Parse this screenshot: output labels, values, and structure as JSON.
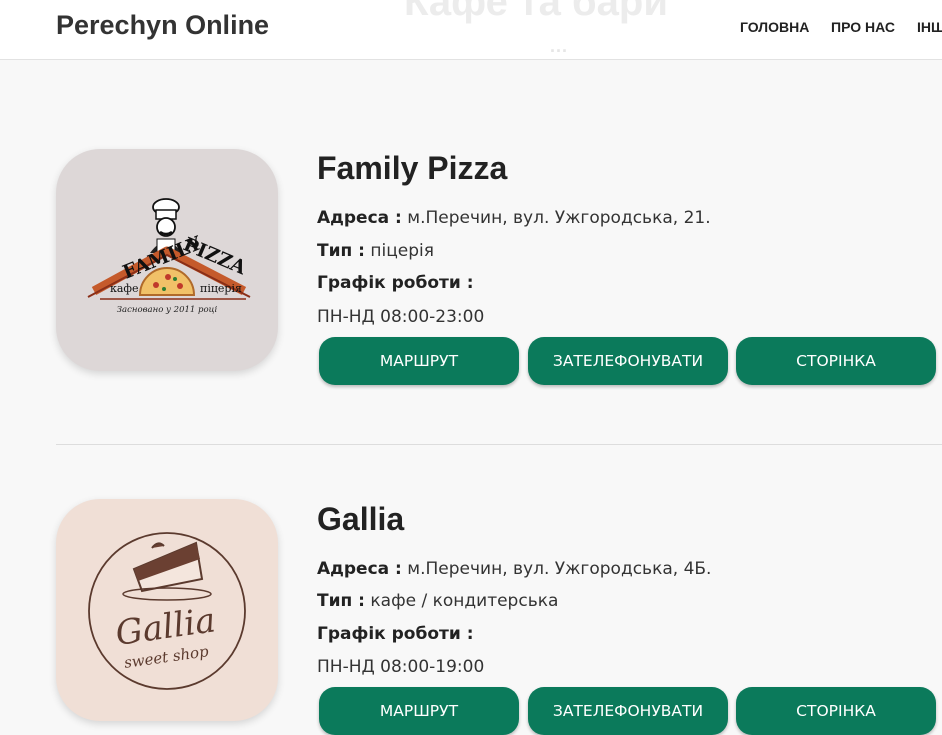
{
  "header": {
    "brand": "Perechyn Online",
    "nav": [
      "ГОЛОВНА",
      "ПРО НАС",
      "ІНШ"
    ],
    "ghost_title": "Кафе та бари",
    "ghost_dots": "..."
  },
  "labels": {
    "address": "Адреса :",
    "type": "Тип :",
    "schedule": "Графік роботи :"
  },
  "places": [
    {
      "name": "Family Pizza",
      "address": "м.Перечин, вул. Ужгородська, 21.",
      "type": "піцерія",
      "hours": "ПН-НД 08:00-23:00",
      "buttons": [
        "МАРШРУТ",
        "ЗАТЕЛЕФОНУВАТИ",
        "СТОРІНКА"
      ],
      "logo": {
        "bg": "#ddd7d7",
        "word1": "FAMILY",
        "word2": "PIZZA",
        "left_tag": "кафе",
        "right_tag": "піцерія",
        "tagline": "Засновано у 2011 році"
      }
    },
    {
      "name": "Gallia",
      "address": "м.Перечин, вул. Ужгородська, 4Б.",
      "type": "кафе / кондитерська",
      "hours": "ПН-НД 08:00-19:00",
      "buttons": [
        "МАРШРУТ",
        "ЗАТЕЛЕФОНУВАТИ",
        "СТОРІНКА"
      ],
      "logo": {
        "bg": "#f0dfd6",
        "script": "Gallia",
        "sub": "sweet shop"
      }
    }
  ],
  "colors": {
    "accent": "#0b7a5b",
    "page_bg": "#f8f8f8"
  }
}
